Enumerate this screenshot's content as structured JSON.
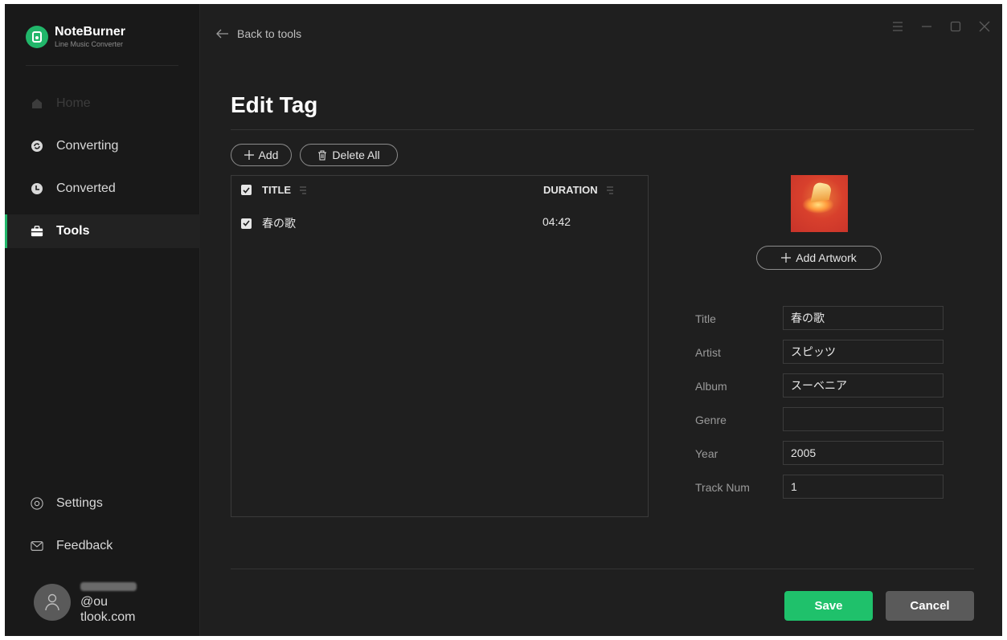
{
  "brand": {
    "name": "NoteBurner",
    "subtitle": "Line Music Converter"
  },
  "nav": [
    {
      "label": "Home",
      "state": "disabled"
    },
    {
      "label": "Converting",
      "state": "normal"
    },
    {
      "label": "Converted",
      "state": "normal"
    },
    {
      "label": "Tools",
      "state": "active"
    }
  ],
  "bottom_nav": [
    {
      "label": "Settings"
    },
    {
      "label": "Feedback"
    }
  ],
  "user": {
    "email_line1": "@ou",
    "email_line2": "tlook.com"
  },
  "header": {
    "back_label": "Back to tools"
  },
  "page": {
    "title": "Edit Tag"
  },
  "toolbar": {
    "add_label": "Add",
    "delete_all_label": "Delete All"
  },
  "table": {
    "columns": [
      "TITLE",
      "DURATION"
    ],
    "rows": [
      {
        "checked": true,
        "title": "春の歌",
        "duration": "04:42"
      }
    ]
  },
  "artwork": {
    "add_label": "Add Artwork"
  },
  "tags": {
    "title": {
      "label": "Title",
      "value": "春の歌"
    },
    "artist": {
      "label": "Artist",
      "value": "スピッツ"
    },
    "album": {
      "label": "Album",
      "value": "スーベニア"
    },
    "genre": {
      "label": "Genre",
      "value": ""
    },
    "year": {
      "label": "Year",
      "value": "2005"
    },
    "track": {
      "label": "Track Num",
      "value": "1"
    }
  },
  "actions": {
    "save_label": "Save",
    "cancel_label": "Cancel"
  },
  "colors": {
    "accent": "#1fc16b",
    "sidebar_bg": "#191919",
    "main_bg": "#1f1f1f",
    "cancel_bg": "#5a5a5a"
  },
  "icons": [
    "app-logo-icon",
    "home-icon",
    "converting-icon",
    "converted-icon",
    "tools-icon",
    "settings-icon",
    "feedback-icon",
    "user-avatar-icon",
    "back-arrow-icon",
    "menu-icon",
    "minimize-icon",
    "maximize-icon",
    "close-icon",
    "plus-icon",
    "trash-icon",
    "checkbox-icon",
    "column-menu-icon"
  ]
}
